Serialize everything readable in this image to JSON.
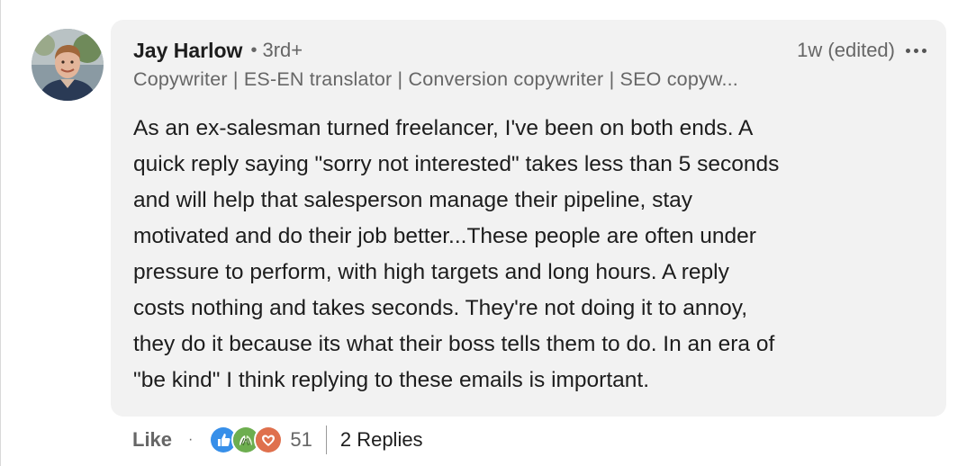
{
  "comment": {
    "author": {
      "name": "Jay Harlow",
      "separator": "•",
      "degree": "3rd+",
      "headline": "Copywriter | ES-EN translator | Conversion copywriter | SEO copyw..."
    },
    "timestamp": "1w (edited)",
    "body_lines": [
      "As an ex-salesman turned freelancer, I've been on both ends. A",
      "quick reply saying \"sorry not interested\" takes less than 5 seconds",
      "and will help that salesperson manage their pipeline, stay",
      "motivated and do their job better...These people are often under",
      "pressure to perform, with high targets and long hours. A reply",
      "costs nothing and takes seconds. They're not doing it to annoy,",
      "they do it because its what their boss tells them to do. In an era of",
      "\"be kind\" I think replying to these emails is important."
    ]
  },
  "actions": {
    "like_label": "Like",
    "separator": "·",
    "reaction_icons": [
      "like-icon",
      "celebrate-icon",
      "love-icon"
    ],
    "reaction_count": "51",
    "replies_label": "2 Replies"
  },
  "colors": {
    "bubble_bg": "#f2f2f2",
    "primary_text": "#1d1d1d",
    "secondary_text": "#666666",
    "like_blue": "#378fe9",
    "celebrate_green": "#44712e",
    "love_red": "#df704d"
  }
}
